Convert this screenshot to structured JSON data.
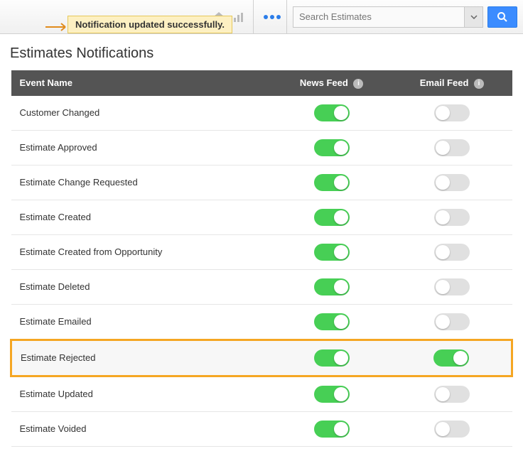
{
  "notification": {
    "message": "Notification updated successfully."
  },
  "search": {
    "placeholder": "Search Estimates"
  },
  "page": {
    "title": "Estimates Notifications"
  },
  "columns": {
    "event": "Event Name",
    "news": "News Feed",
    "email": "Email Feed"
  },
  "info_glyph": "i",
  "rows": [
    {
      "event": "Customer Changed",
      "news": true,
      "email": false,
      "highlight": false
    },
    {
      "event": "Estimate Approved",
      "news": true,
      "email": false,
      "highlight": false
    },
    {
      "event": "Estimate Change Requested",
      "news": true,
      "email": false,
      "highlight": false
    },
    {
      "event": "Estimate Created",
      "news": true,
      "email": false,
      "highlight": false
    },
    {
      "event": "Estimate Created from Opportunity",
      "news": true,
      "email": false,
      "highlight": false
    },
    {
      "event": "Estimate Deleted",
      "news": true,
      "email": false,
      "highlight": false
    },
    {
      "event": "Estimate Emailed",
      "news": true,
      "email": false,
      "highlight": false
    },
    {
      "event": "Estimate Rejected",
      "news": true,
      "email": true,
      "highlight": true
    },
    {
      "event": "Estimate Updated",
      "news": true,
      "email": false,
      "highlight": false
    },
    {
      "event": "Estimate Voided",
      "news": true,
      "email": false,
      "highlight": false
    }
  ]
}
